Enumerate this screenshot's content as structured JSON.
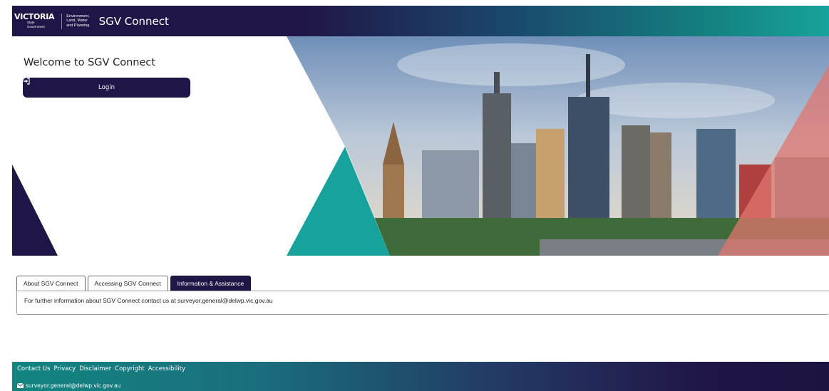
{
  "header": {
    "logo_word": "VICTORIA",
    "logo_sub": [
      "State",
      "Government"
    ],
    "dept_lines": [
      "Environment,",
      "Land, Water",
      "and Planning"
    ],
    "app_title": "SGV Connect"
  },
  "hero": {
    "welcome": "Welcome to SGV Connect",
    "login_label": "Login",
    "login_icon": "sign-in-icon"
  },
  "tabs": [
    {
      "label": "About SGV Connect",
      "active": false
    },
    {
      "label": "Accessing SGV Connect",
      "active": false
    },
    {
      "label": "Information & Assistance",
      "active": true
    }
  ],
  "tab_panel": {
    "text": "For further information about SGV Connect contact us at surveyor.general@delwp.vic.gov.au"
  },
  "footer": {
    "links": [
      "Contact Us",
      "Privacy",
      "Disclaimer",
      "Copyright",
      "Accessibility"
    ],
    "email": "surveyor.general@delwp.vic.gov.au",
    "email_icon": "envelope-icon"
  },
  "colors": {
    "navy": "#201547",
    "teal": "#17a39c",
    "coral": "#e0766e"
  }
}
